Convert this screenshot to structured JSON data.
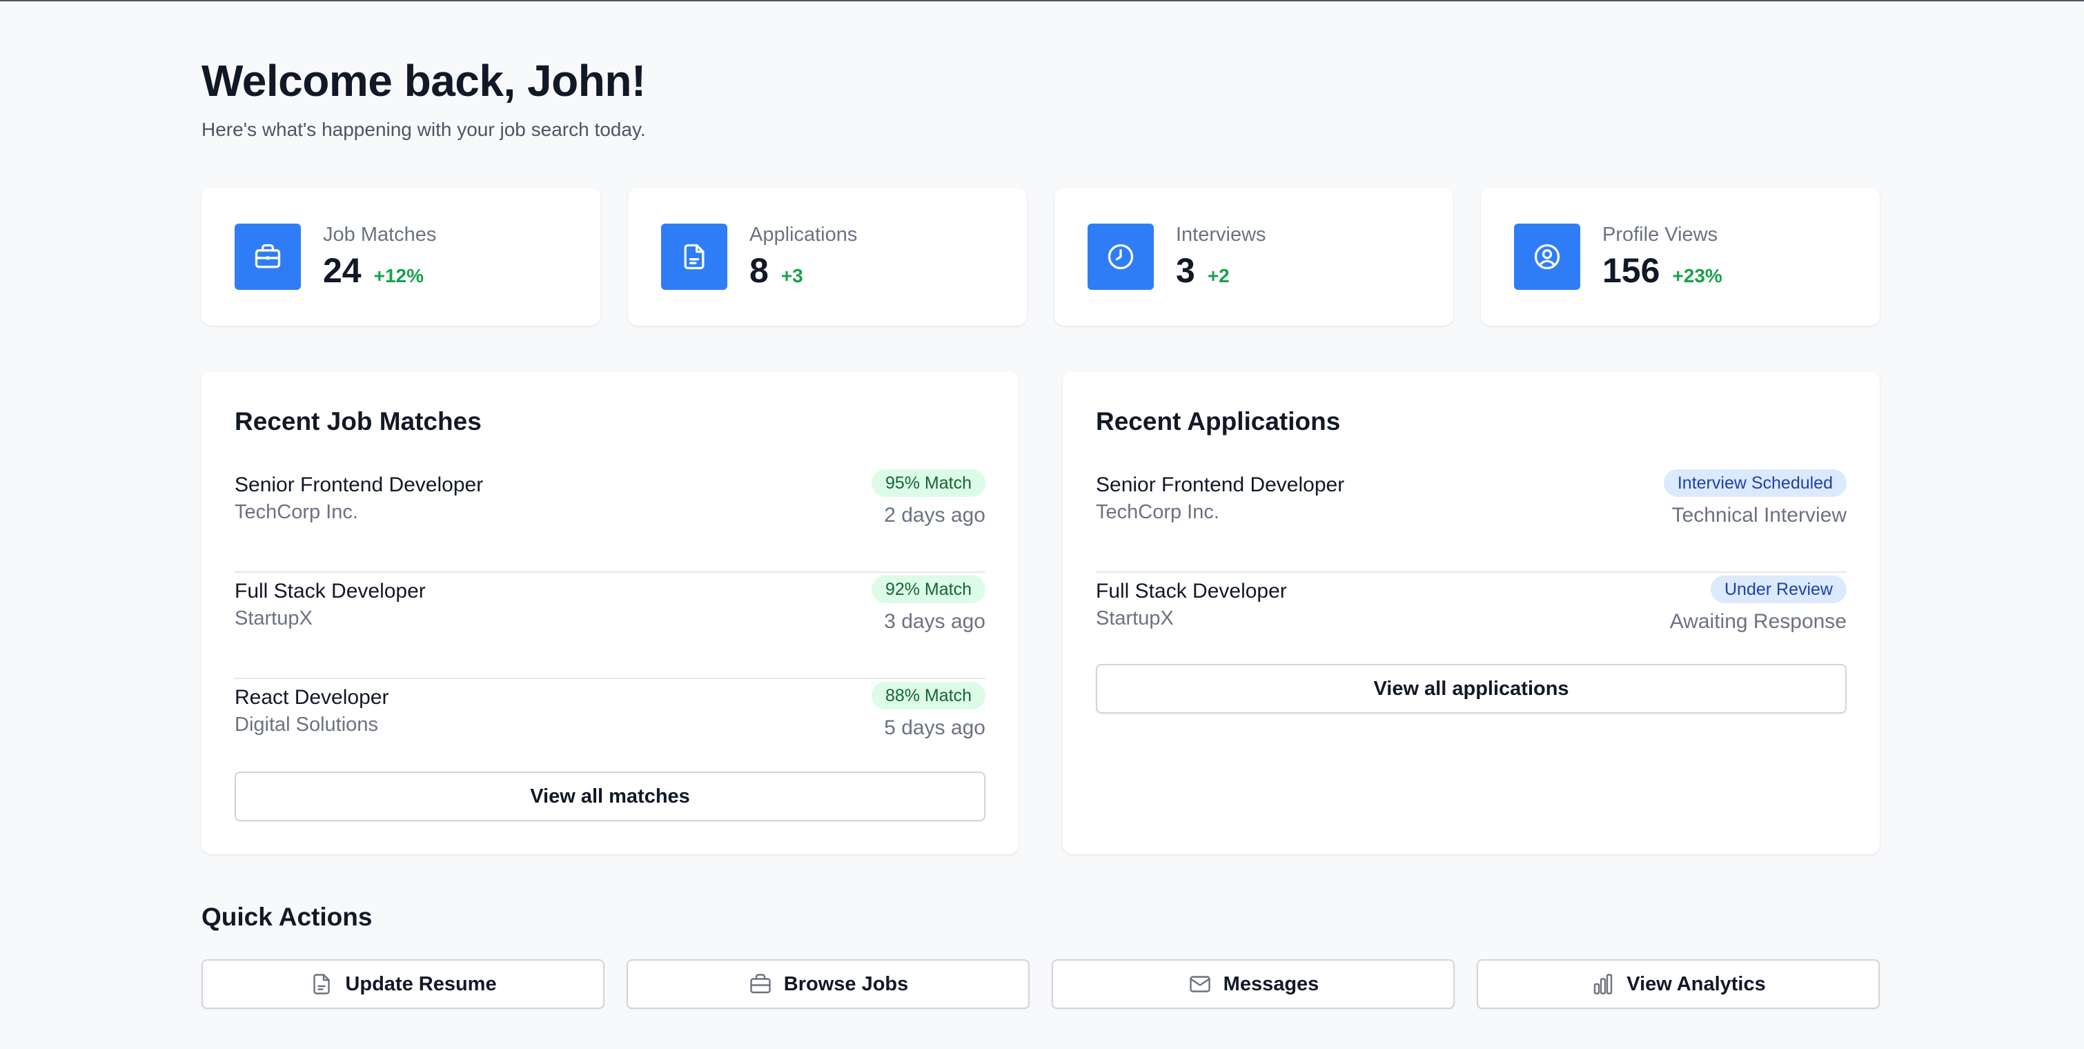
{
  "header": {
    "title": "Welcome back, John!",
    "subtitle": "Here's what's happening with your job search today."
  },
  "stats": [
    {
      "label": "Job Matches",
      "value": "24",
      "delta": "+12%",
      "icon": "briefcase-icon"
    },
    {
      "label": "Applications",
      "value": "8",
      "delta": "+3",
      "icon": "document-icon"
    },
    {
      "label": "Interviews",
      "value": "3",
      "delta": "+2",
      "icon": "clock-icon"
    },
    {
      "label": "Profile Views",
      "value": "156",
      "delta": "+23%",
      "icon": "user-circle-icon"
    }
  ],
  "recent_matches": {
    "title": "Recent Job Matches",
    "items": [
      {
        "title": "Senior Frontend Developer",
        "company": "TechCorp Inc.",
        "badge": "95% Match",
        "time": "2 days ago"
      },
      {
        "title": "Full Stack Developer",
        "company": "StartupX",
        "badge": "92% Match",
        "time": "3 days ago"
      },
      {
        "title": "React Developer",
        "company": "Digital Solutions",
        "badge": "88% Match",
        "time": "5 days ago"
      }
    ],
    "button_label": "View all matches"
  },
  "recent_applications": {
    "title": "Recent Applications",
    "items": [
      {
        "title": "Senior Frontend Developer",
        "company": "TechCorp Inc.",
        "badge": "Interview Scheduled",
        "status": "Technical Interview"
      },
      {
        "title": "Full Stack Developer",
        "company": "StartupX",
        "badge": "Under Review",
        "status": "Awaiting Response"
      }
    ],
    "button_label": "View all applications"
  },
  "quick_actions": {
    "title": "Quick Actions",
    "buttons": [
      {
        "label": "Update Resume",
        "icon": "document-icon"
      },
      {
        "label": "Browse Jobs",
        "icon": "briefcase-icon"
      },
      {
        "label": "Messages",
        "icon": "mail-icon"
      },
      {
        "label": "View Analytics",
        "icon": "bar-chart-icon"
      }
    ]
  },
  "colors": {
    "accent": "#2f7df6",
    "positive": "#16a34a",
    "match_badge_bg": "#dcfce7",
    "status_badge_bg": "#dbeafe"
  }
}
